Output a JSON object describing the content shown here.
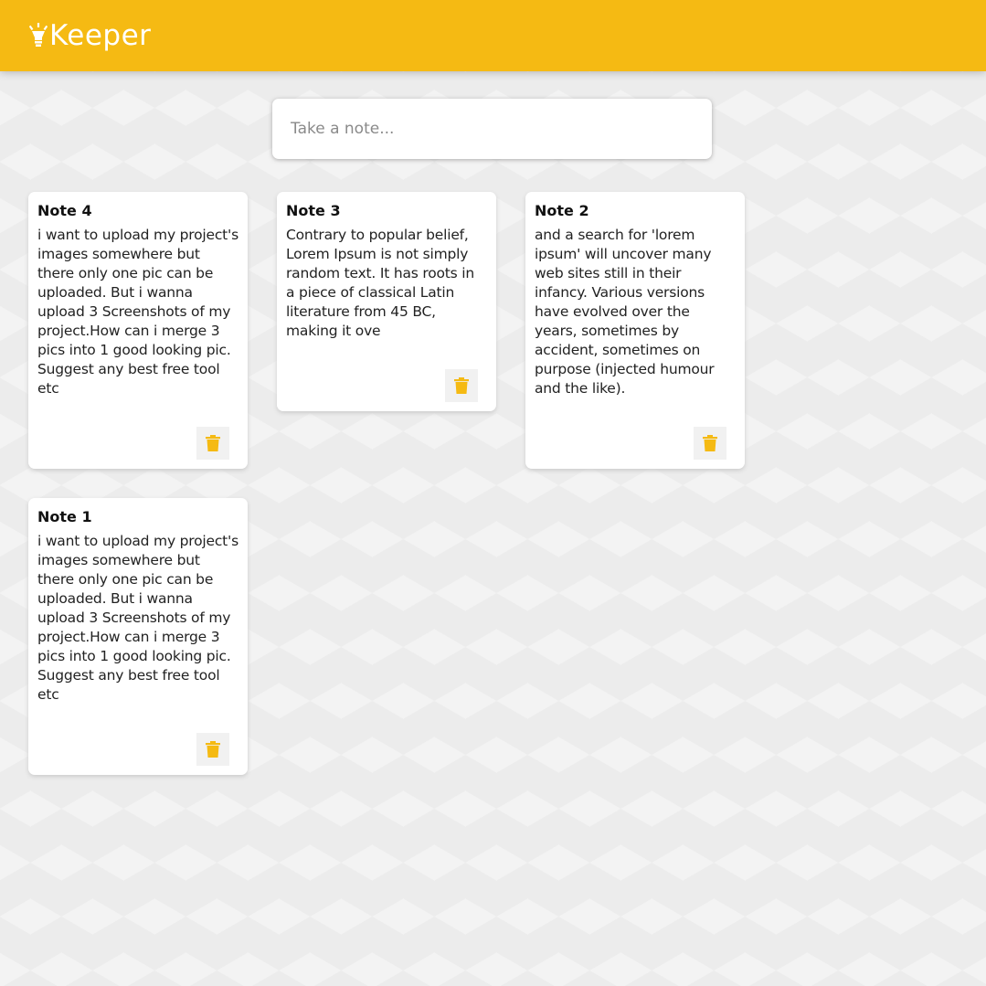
{
  "header": {
    "logo_icon": "lightbulb-icon",
    "app_title": "Keeper",
    "accent_color": "#f5ba13"
  },
  "create_note": {
    "placeholder": "Take a note..."
  },
  "notes": [
    {
      "title": "Note 4",
      "content": "i want to upload my project's images somewhere but there only one pic can be uploaded. But i wanna upload 3 Screenshots of my project.How can i merge 3 pics into 1 good looking pic. Suggest any best free tool etc",
      "delete_icon": "trash-icon"
    },
    {
      "title": "Note 3",
      "content": "Contrary to popular belief, Lorem Ipsum is not simply random text. It has roots in a piece of classical Latin literature from 45 BC, making it ove",
      "delete_icon": "trash-icon"
    },
    {
      "title": "Note 2",
      "content": "and a search for 'lorem ipsum' will uncover many web sites still in their infancy. Various versions have evolved over the years, sometimes by accident, sometimes on purpose (injected humour and the like).",
      "delete_icon": "trash-icon"
    },
    {
      "title": "Note 1",
      "content": "i want to upload my project's images somewhere but there only one pic can be uploaded. But i wanna upload 3 Screenshots of my project.How can i merge 3 pics into 1 good looking pic. Suggest any best free tool etc",
      "delete_icon": "trash-icon"
    }
  ]
}
